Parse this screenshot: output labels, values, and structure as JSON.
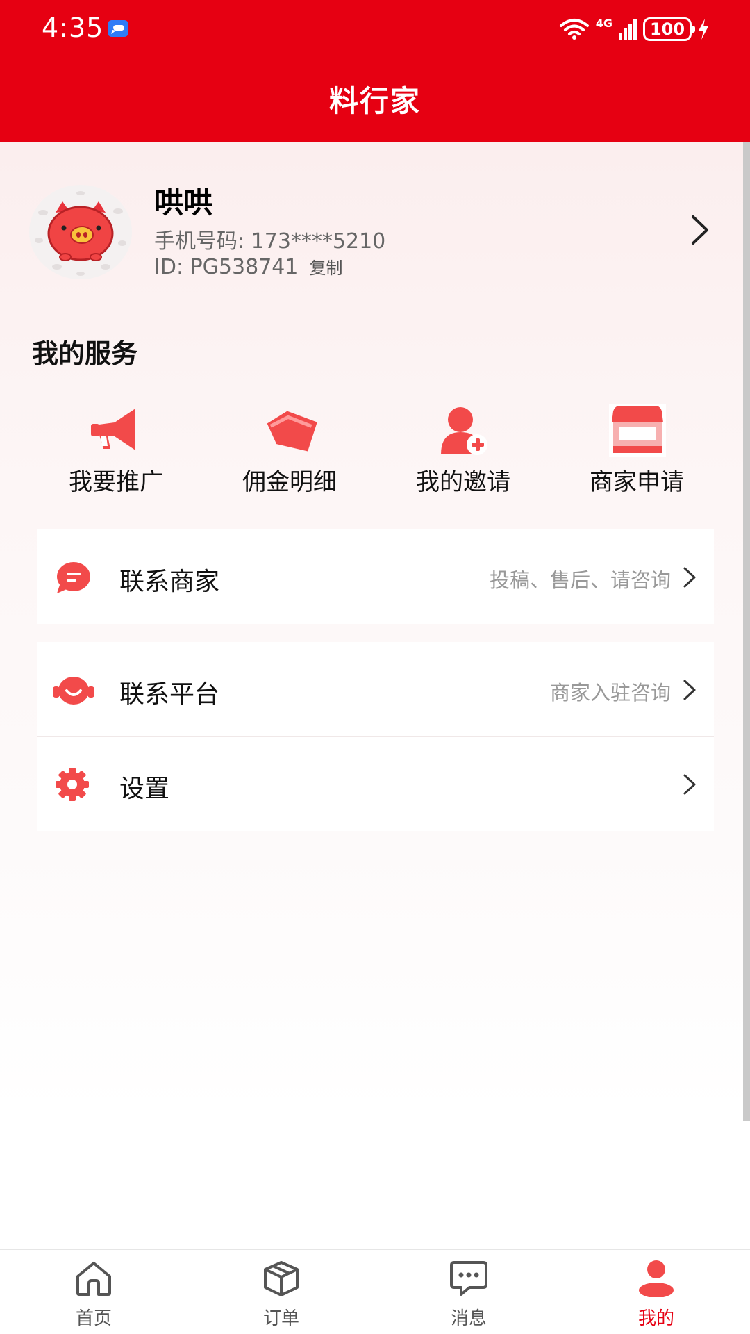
{
  "status_bar": {
    "time": "4:35",
    "network": "4G",
    "battery": "100"
  },
  "header": {
    "title": "料行家"
  },
  "profile": {
    "name": "哄哄",
    "phone": "手机号码: 173****5210",
    "id": "ID: PG538741",
    "copy_label": "复制"
  },
  "services": {
    "title": "我的服务",
    "items": [
      {
        "label": "我要推广",
        "icon": "megaphone-icon"
      },
      {
        "label": "佣金明细",
        "icon": "price-tag-icon"
      },
      {
        "label": "我的邀请",
        "icon": "add-user-icon"
      },
      {
        "label": "商家申请",
        "icon": "storefront-icon"
      }
    ]
  },
  "menu": {
    "contact_merchant": {
      "label": "联系商家",
      "hint": "投稿、售后、请咨询"
    },
    "contact_platform": {
      "label": "联系平台",
      "hint": "商家入驻咨询"
    },
    "settings": {
      "label": "设置"
    }
  },
  "tabbar": {
    "items": [
      {
        "label": "首页",
        "icon": "home-icon"
      },
      {
        "label": "订单",
        "icon": "package-icon"
      },
      {
        "label": "消息",
        "icon": "message-icon"
      },
      {
        "label": "我的",
        "icon": "user-icon"
      }
    ],
    "active_index": 3
  },
  "colors": {
    "brand_red": "#e60012",
    "icon_red": "#f24a4a",
    "hint_gray": "#999999"
  }
}
